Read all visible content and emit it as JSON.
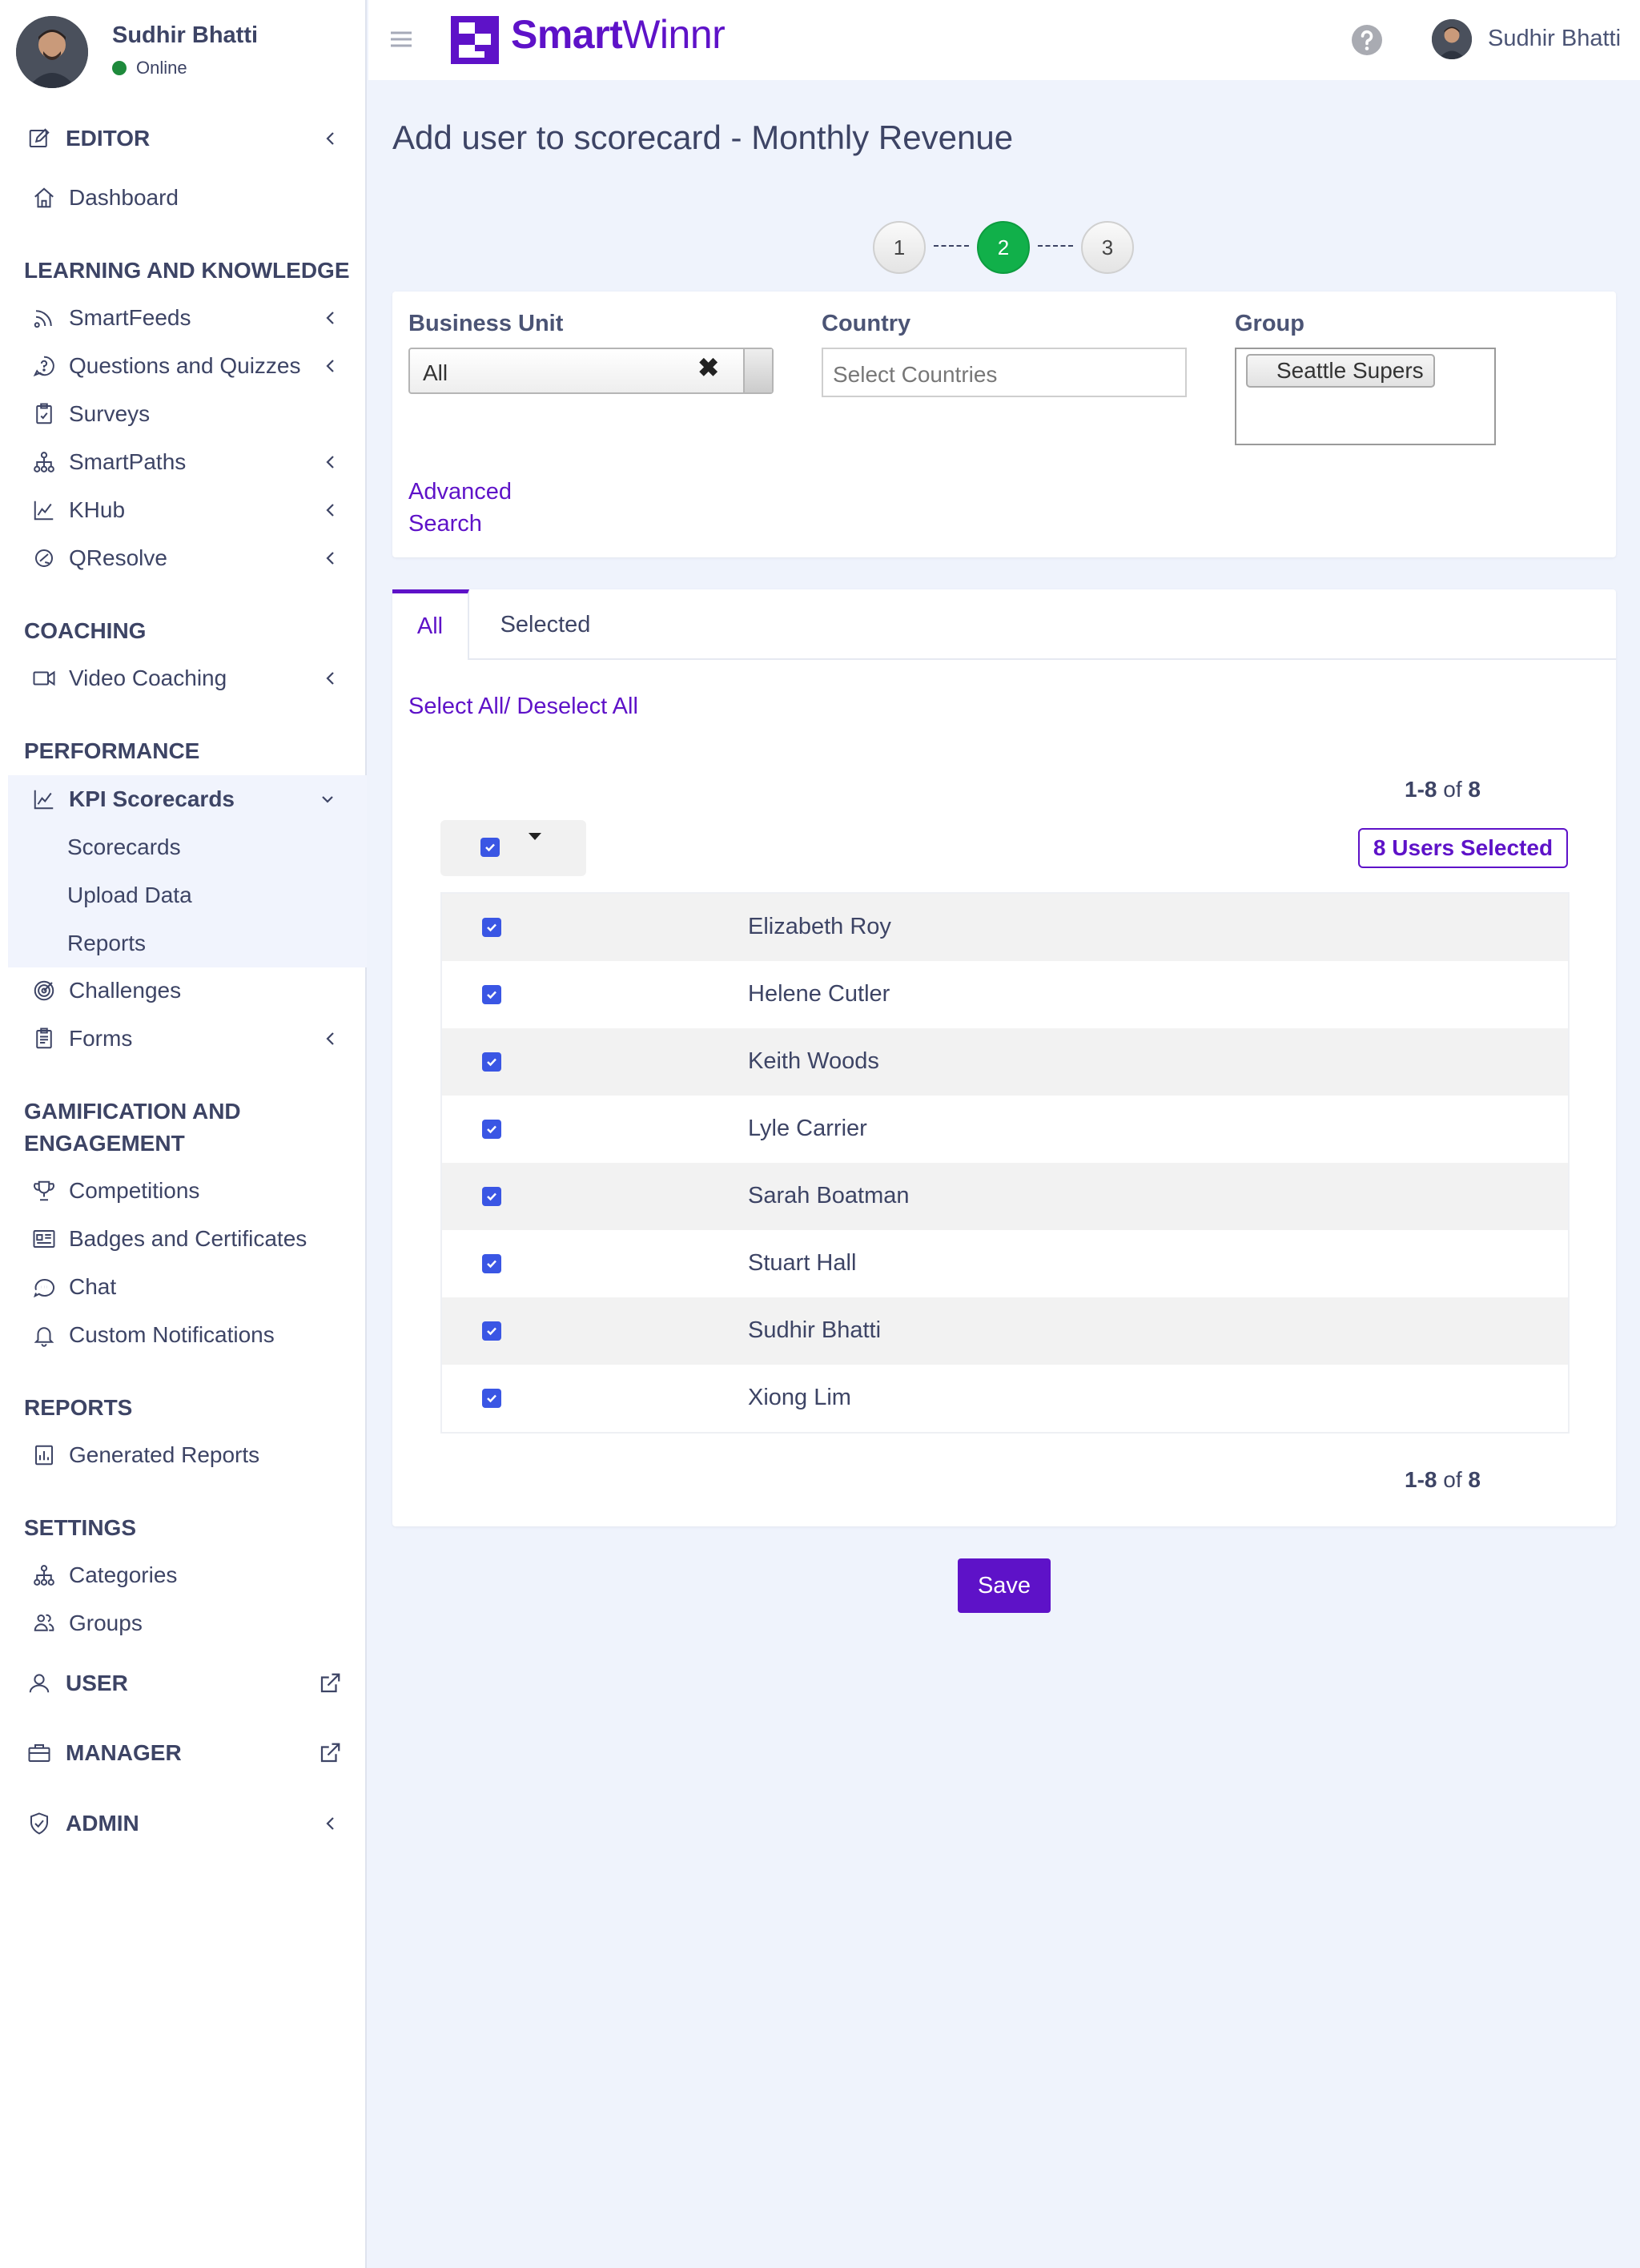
{
  "profile": {
    "name": "Sudhir Bhatti",
    "status": "Online"
  },
  "sidebar": {
    "editor": "EDITOR",
    "dashboard": "Dashboard",
    "sections": {
      "learning": "LEARNING AND KNOWLEDGE",
      "coaching": "COACHING",
      "performance": "PERFORMANCE",
      "gamification_1": "GAMIFICATION AND",
      "gamification_2": "ENGAGEMENT",
      "reports": "REPORTS",
      "settings": "SETTINGS"
    },
    "learning_items": [
      "SmartFeeds",
      "Questions and Quizzes",
      "Surveys",
      "SmartPaths",
      "KHub",
      "QResolve"
    ],
    "coaching_items": [
      "Video Coaching"
    ],
    "kpi": "KPI Scorecards",
    "kpi_sub": [
      "Scorecards",
      "Upload Data",
      "Reports"
    ],
    "performance_items": [
      "Challenges",
      "Forms"
    ],
    "gamification_items": [
      "Competitions",
      "Badges and Certificates",
      "Chat",
      "Custom Notifications"
    ],
    "reports_items": [
      "Generated Reports"
    ],
    "settings_items": [
      "Categories",
      "Groups"
    ],
    "user": "USER",
    "manager": "MANAGER",
    "admin": "ADMIN"
  },
  "topbar": {
    "logo_bold": "Smart",
    "logo_rest": "Winnr",
    "user_name": "Sudhir Bhatti"
  },
  "page": {
    "title": "Add user to scorecard - Monthly Revenue"
  },
  "stepper": {
    "steps": [
      "1",
      "2",
      "3"
    ],
    "active": "2"
  },
  "filters": {
    "business_unit_label": "Business Unit",
    "business_unit_value": "All",
    "country_label": "Country",
    "country_placeholder": "Select Countries",
    "group_label": "Group",
    "group_chip": "Seattle Supers",
    "advanced_1": "Advanced",
    "advanced_2": "Search"
  },
  "tabs": {
    "all": "All",
    "selected": "Selected"
  },
  "list": {
    "select_all": "Select All/ Deselect All",
    "range": "1-8",
    "of": "of",
    "total": "8",
    "selected_badge": "8 Users Selected",
    "users": [
      "Elizabeth Roy",
      "Helene Cutler",
      "Keith Woods",
      "Lyle Carrier",
      "Sarah Boatman",
      "Stuart Hall",
      "Sudhir Bhatti",
      "Xiong Lim"
    ]
  },
  "save_label": "Save",
  "colors": {
    "accent": "#5e12c8",
    "step_active": "#11b04a",
    "checkbox": "#3a56e4",
    "online": "#1e8a3c"
  }
}
